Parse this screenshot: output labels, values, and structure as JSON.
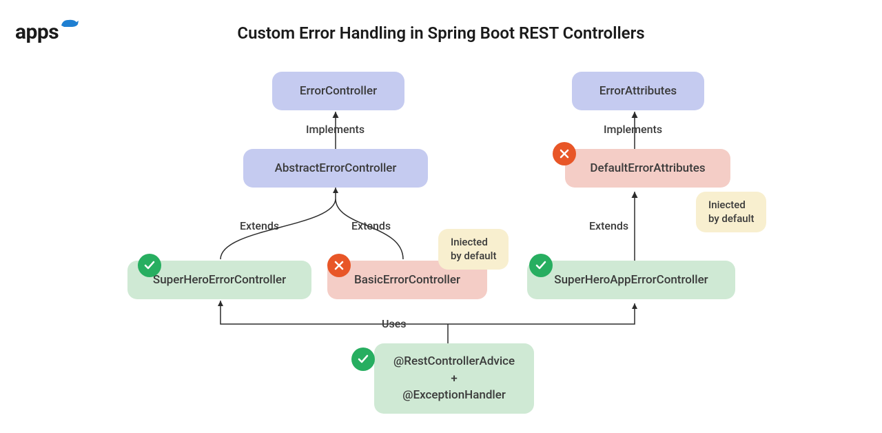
{
  "logo_text": "apps",
  "title": "Custom Error Handling in Spring Boot REST Controllers",
  "nodes": {
    "error_controller": "ErrorController",
    "abstract_error_controller": "AbstractErrorController",
    "superhero_error_controller": "SuperHeroErrorController",
    "basic_error_controller": "BasicErrorController",
    "error_attributes": "ErrorAttributes",
    "default_error_attributes": "DefaultErrorAttributes",
    "superhero_app_error_controller": "SuperHeroAppErrorController",
    "advice_line1": "@RestControllerAdvice",
    "advice_plus": "+",
    "advice_line2": "@ExceptionHandler"
  },
  "labels": {
    "implements": "Implements",
    "extends": "Extends",
    "uses": "Uses",
    "injected1": "Iniected",
    "injected2": "by default"
  }
}
